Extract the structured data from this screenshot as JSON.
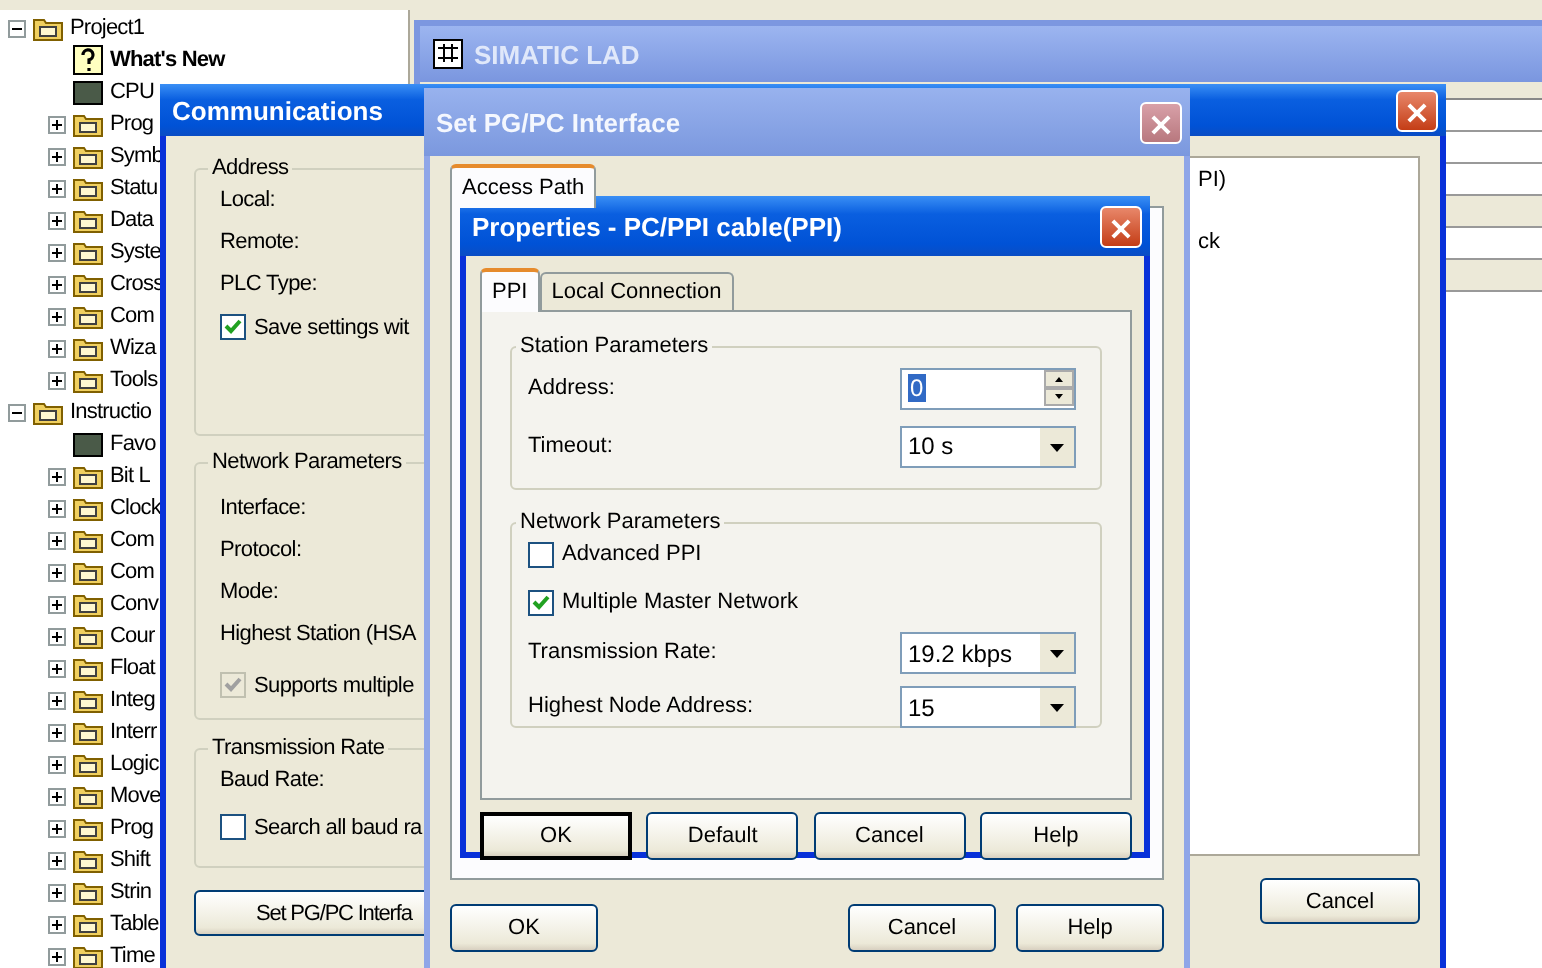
{
  "project_tree": {
    "items": [
      {
        "label": "Project1",
        "kind": "group",
        "expanded": true,
        "children": [
          {
            "label": "What's New",
            "kind": "featured"
          },
          {
            "label": "CPU",
            "kind": "leaf"
          },
          {
            "label": "Prog",
            "kind": "group",
            "expanded": false
          },
          {
            "label": "Symb",
            "kind": "group",
            "expanded": false
          },
          {
            "label": "Statu",
            "kind": "group",
            "expanded": false
          },
          {
            "label": "Data",
            "kind": "group",
            "expanded": false
          },
          {
            "label": "Syste",
            "kind": "group",
            "expanded": false
          },
          {
            "label": "Cross",
            "kind": "group",
            "expanded": false
          },
          {
            "label": "Com",
            "kind": "group",
            "expanded": false
          },
          {
            "label": "Wiza",
            "kind": "group",
            "expanded": false
          },
          {
            "label": "Tools",
            "kind": "group",
            "expanded": false
          }
        ]
      },
      {
        "label": "Instructio",
        "kind": "group",
        "expanded": true,
        "children": [
          {
            "label": "Favo",
            "kind": "leaf"
          },
          {
            "label": "Bit L",
            "kind": "group",
            "expanded": false
          },
          {
            "label": "Clock",
            "kind": "group",
            "expanded": false
          },
          {
            "label": "Com",
            "kind": "group",
            "expanded": false
          },
          {
            "label": "Com",
            "kind": "group",
            "expanded": false
          },
          {
            "label": "Conv",
            "kind": "group",
            "expanded": false
          },
          {
            "label": "Cour",
            "kind": "group",
            "expanded": false
          },
          {
            "label": "Float",
            "kind": "group",
            "expanded": false
          },
          {
            "label": "Integ",
            "kind": "group",
            "expanded": false
          },
          {
            "label": "Interr",
            "kind": "group",
            "expanded": false
          },
          {
            "label": "Logic",
            "kind": "group",
            "expanded": false
          },
          {
            "label": "Move",
            "kind": "group",
            "expanded": false
          },
          {
            "label": "Prog",
            "kind": "group",
            "expanded": false
          },
          {
            "label": "Shift",
            "kind": "group",
            "expanded": false
          },
          {
            "label": "Strin",
            "kind": "group",
            "expanded": false
          },
          {
            "label": "Table",
            "kind": "group",
            "expanded": false
          },
          {
            "label": "Time",
            "kind": "group",
            "expanded": false
          }
        ]
      }
    ]
  },
  "lad_window": {
    "title": "SIMATIC LAD"
  },
  "communications": {
    "title": "Communications",
    "address": {
      "title": "Address",
      "fields": [
        "Local:",
        "Remote:",
        "PLC Type:"
      ],
      "option": {
        "label": "Save settings wit",
        "checked": true,
        "disabled": false
      }
    },
    "network": {
      "title": "Network Parameters",
      "fields": [
        "Interface:",
        "Protocol:",
        "Mode:",
        "Highest Station (HSA"
      ],
      "option": {
        "label": "Supports multiple",
        "checked": true,
        "disabled": true
      }
    },
    "rate": {
      "title": "Transmission Rate",
      "fields": [
        "Baud Rate:"
      ],
      "option": {
        "label": "Search all baud ra",
        "checked": false,
        "disabled": false
      }
    },
    "set_button": "Set PG/PC Interfa",
    "list_items": [
      "PI)",
      "ck"
    ],
    "cancel_button": "Cancel"
  },
  "pgpc": {
    "title": "Set PG/PC Interface",
    "tabs": [
      {
        "label": "Access Path",
        "selected": true
      }
    ],
    "buttons": [
      "OK",
      "Cancel",
      "Help"
    ]
  },
  "properties": {
    "title": "Properties - PC/PPI cable(PPI)",
    "tabs": [
      {
        "label": "PPI",
        "selected": true
      },
      {
        "label": "Local Connection",
        "selected": false
      }
    ],
    "station": {
      "title": "Station Parameters",
      "address": {
        "label": "Address:",
        "value": "0"
      },
      "timeout": {
        "label": "Timeout:",
        "value": "10 s"
      }
    },
    "network": {
      "title": "Network Parameters",
      "advanced_ppi": {
        "label": "Advanced PPI",
        "checked": false
      },
      "multi_master": {
        "label": "Multiple Master Network",
        "checked": true
      },
      "rate": {
        "label": "Transmission Rate:",
        "value": "19.2 kbps"
      },
      "highest_node": {
        "label": "Highest Node Address:",
        "value": "15"
      }
    },
    "buttons": [
      {
        "label": "OK",
        "default": true
      },
      {
        "label": "Default",
        "default": false
      },
      {
        "label": "Cancel",
        "default": false
      },
      {
        "label": "Help",
        "default": false
      }
    ]
  }
}
